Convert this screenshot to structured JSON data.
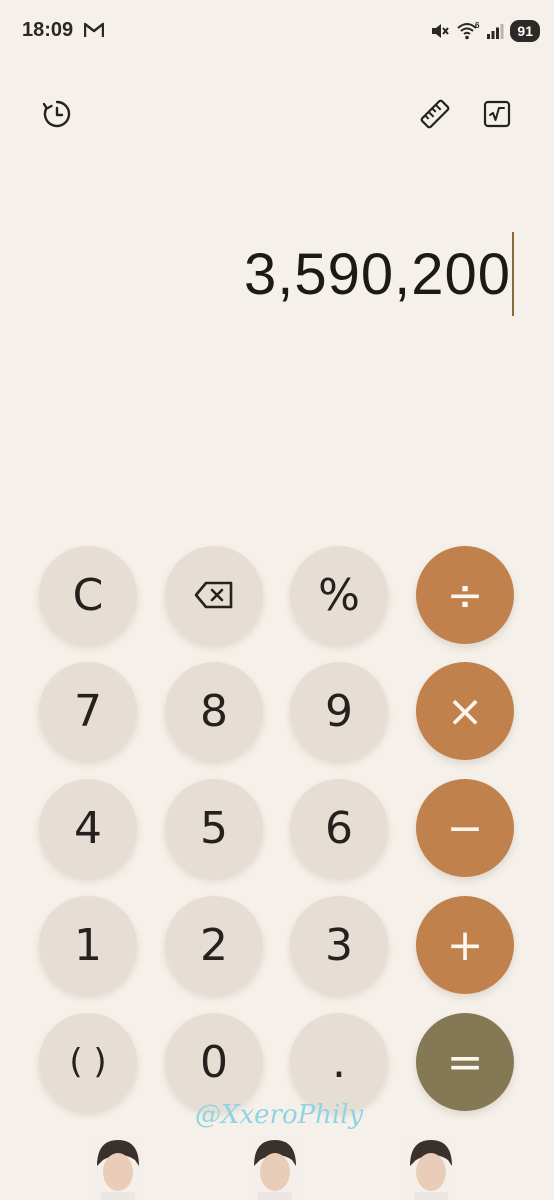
{
  "status_bar": {
    "time": "18:09",
    "battery": "91",
    "network_badge": "6"
  },
  "toolbar": {
    "history_icon": "history-icon",
    "units_icon": "ruler-icon",
    "scientific_icon": "square-root-icon"
  },
  "display": {
    "value": "3,590,200"
  },
  "keypad": {
    "clear": "C",
    "percent": "%",
    "divide": "÷",
    "k7": "7",
    "k8": "8",
    "k9": "9",
    "multiply": "×",
    "k4": "4",
    "k5": "5",
    "k6": "6",
    "subtract": "−",
    "k1": "1",
    "k2": "2",
    "k3": "3",
    "add": "+",
    "parens": "( )",
    "k0": "0",
    "decimal": ".",
    "equals": "="
  },
  "colors": {
    "operator": "#c0814c",
    "equals": "#857955",
    "digit": "#e6ded4",
    "background": "#f5f1ea"
  },
  "watermark": "@XxeroPhily"
}
